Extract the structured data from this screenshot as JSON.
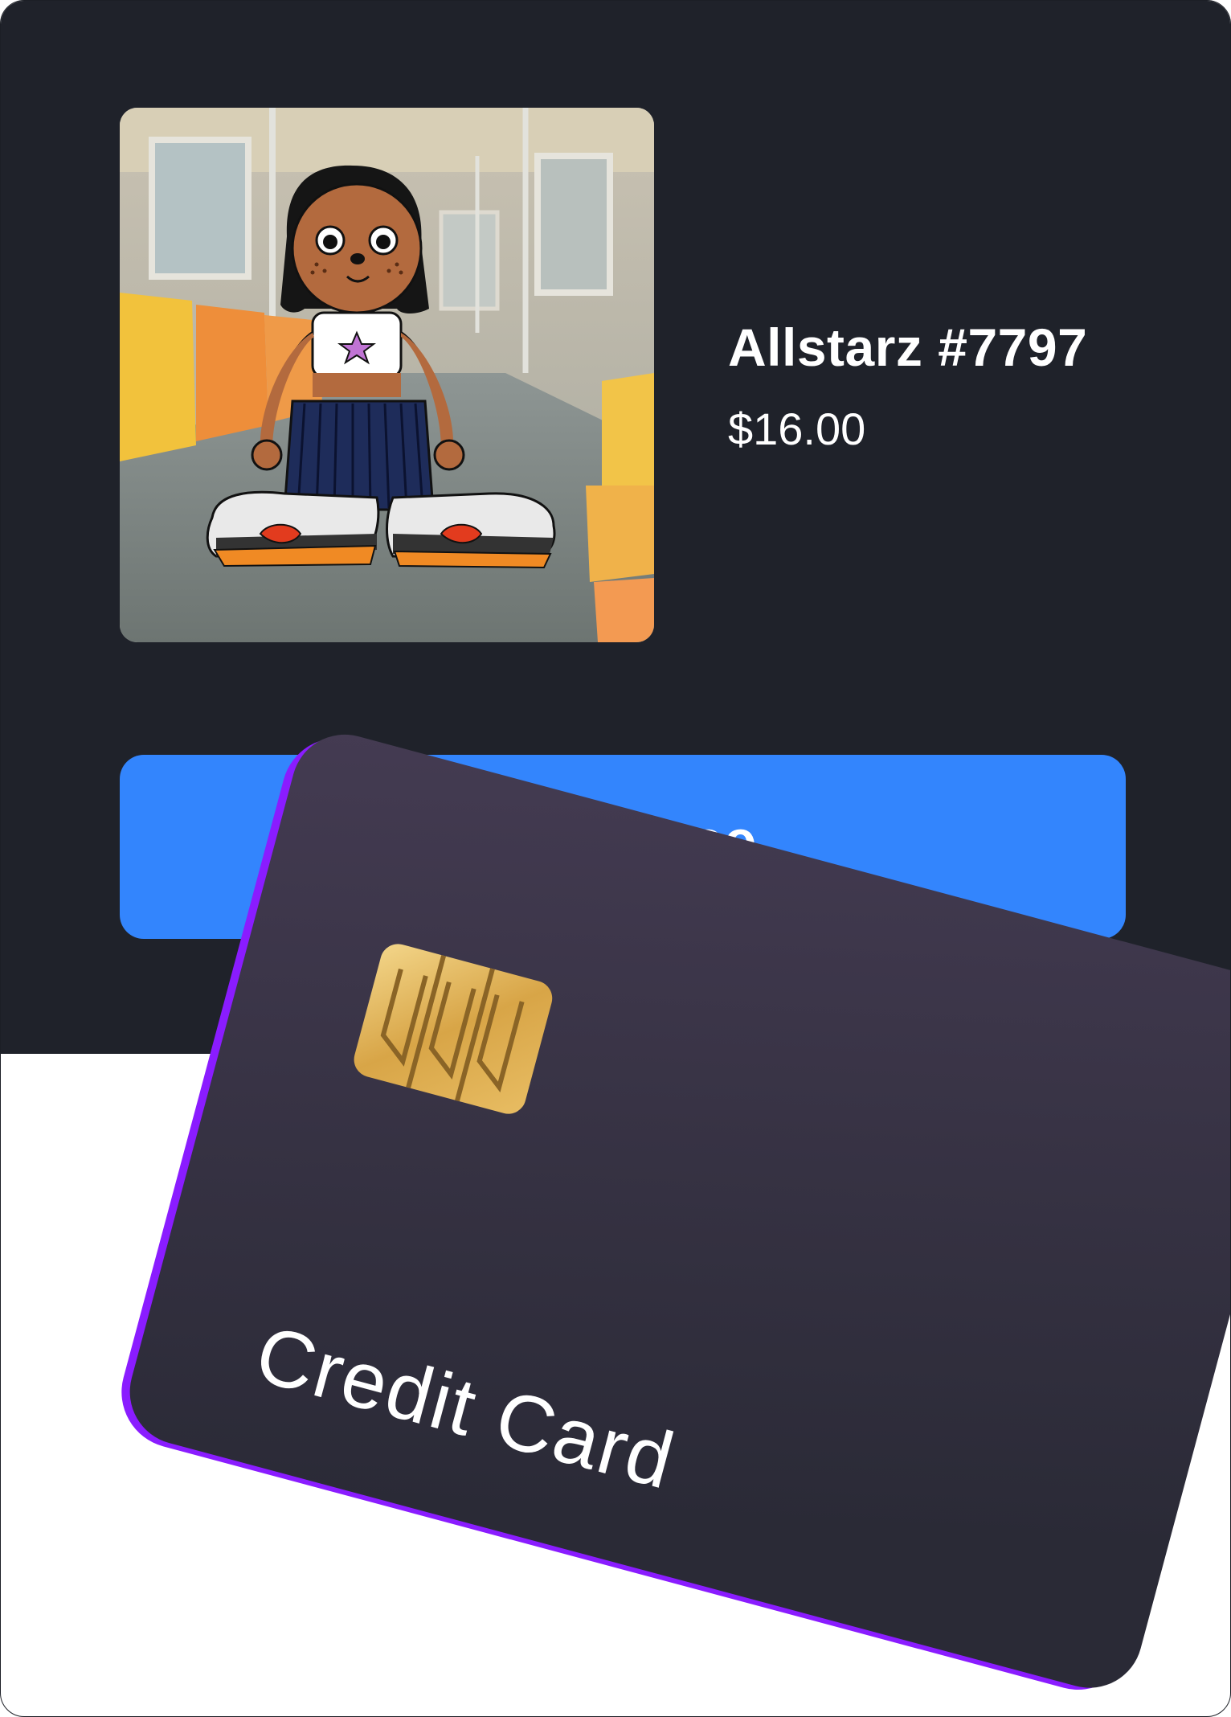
{
  "product": {
    "title": "Allstarz #7797",
    "price": "$16.00",
    "image_icon": "nft-character-image"
  },
  "actions": {
    "purchase_label": "Purchase"
  },
  "payment_card": {
    "label": "Credit Card",
    "chip_icon": "card-chip-icon"
  },
  "colors": {
    "panel_background": "#1f222a",
    "button_accent": "#3385fd",
    "card_background": "#34313f",
    "card_edge": "#8a1cff",
    "chip_gold": "#d9a94a"
  }
}
